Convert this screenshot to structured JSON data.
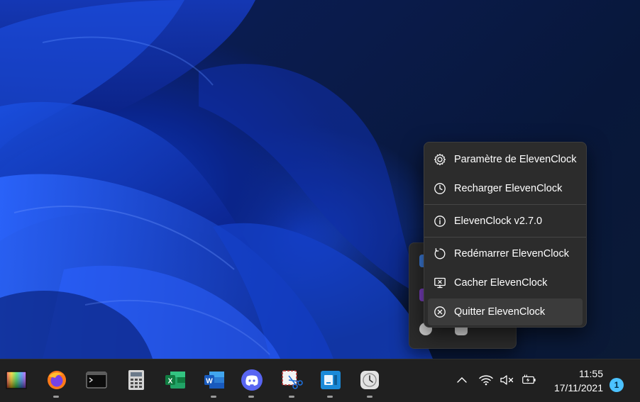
{
  "context_menu": {
    "items": [
      {
        "label": "Paramètre de ElevenClock",
        "icon": "gear-icon"
      },
      {
        "label": "Recharger ElevenClock",
        "icon": "clock-icon"
      },
      {
        "label": "ElevenClock v2.7.0",
        "icon": "info-icon"
      },
      {
        "label": "Redémarrer ElevenClock",
        "icon": "restart-icon"
      },
      {
        "label": "Cacher ElevenClock",
        "icon": "hide-screen-icon"
      },
      {
        "label": "Quitter ElevenClock",
        "icon": "close-circle-icon"
      }
    ],
    "hovered_index": 5
  },
  "taskbar": {
    "apps": [
      "color-grid-app-icon",
      "firefox-icon",
      "terminal-icon",
      "calculator-icon",
      "excel-icon",
      "word-icon",
      "discord-icon",
      "snipping-tool-icon",
      "app-window-icon",
      "elevenclock-icon"
    ],
    "tray": [
      "chevron-up-icon",
      "wifi-icon",
      "mute-icon",
      "battery-charging-icon"
    ],
    "time": "11:55",
    "date": "17/11/2021",
    "notification_count": "1"
  },
  "colors": {
    "accent": "#4cc2ff",
    "menu_bg": "#2c2c2c",
    "taskbar_bg": "#202020"
  }
}
